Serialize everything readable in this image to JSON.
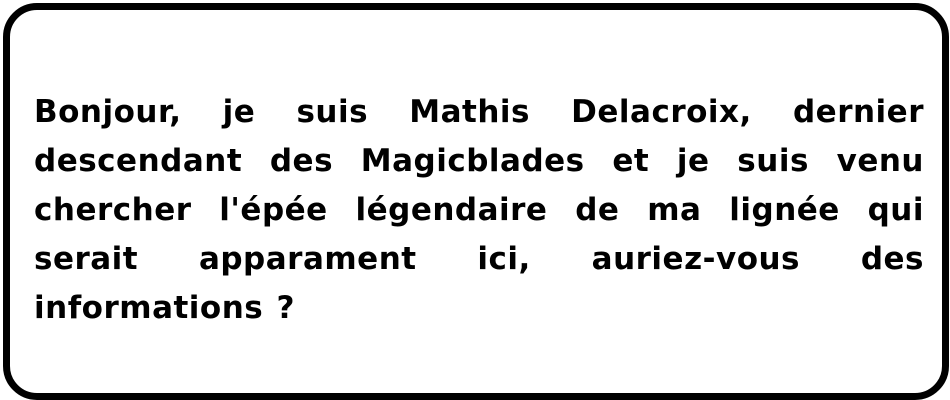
{
  "dialog": {
    "text": "Bonjour, je suis Mathis Delacroix, dernier descendant des Magicblades et je suis venu chercher l'épée légendaire de ma lignée qui serait apparament ici, auriez-vous des informations ?"
  },
  "colors": {
    "border": "#000000",
    "background": "#ffffff",
    "text": "#000000"
  }
}
